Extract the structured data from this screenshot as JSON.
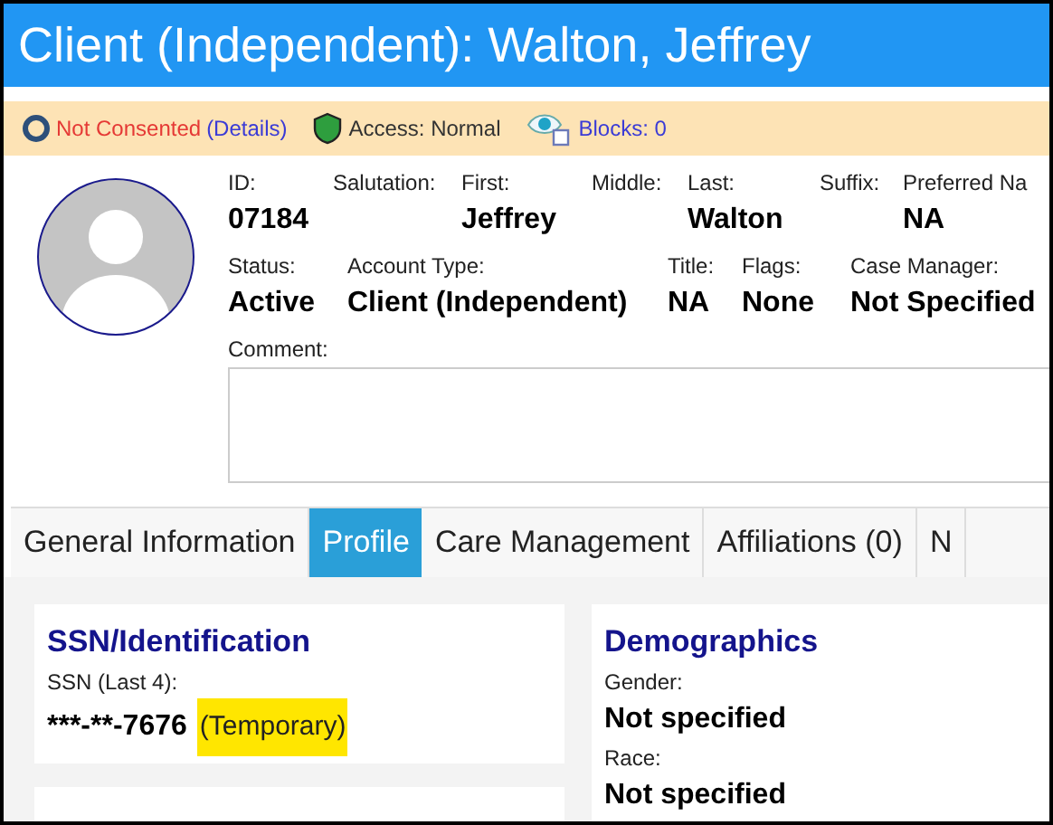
{
  "window": {
    "title": "Client (Independent): Walton, Jeffrey"
  },
  "banner": {
    "consent": "Not Consented",
    "details_link": "(Details)",
    "access": "Access: Normal",
    "blocks_link": "Blocks: 0"
  },
  "field_rows": [
    [
      {
        "label": "ID:",
        "value": "07184"
      },
      {
        "label": "Salutation:"
      },
      {
        "label": "First:",
        "value": "Jeffrey"
      },
      {
        "label": "Middle:"
      },
      {
        "label": "Last:",
        "value": "Walton"
      },
      {
        "label": "Suffix:"
      },
      {
        "label": "Preferred Na",
        "value": "NA"
      }
    ],
    [
      {
        "label": "Status:",
        "value": "Active"
      },
      {
        "label": "Account Type:",
        "value": "Client (Independent)"
      },
      {
        "label": "Title:",
        "value": "NA"
      },
      {
        "label": "Flags:",
        "value": "None"
      },
      {
        "label": "Case Manager:",
        "value": "Not Specified"
      }
    ]
  ],
  "comment": {
    "label": "Comment:"
  },
  "tabs": [
    {
      "label": "General Information",
      "selected": false
    },
    {
      "label": "Profile",
      "selected": true
    },
    {
      "label": "Care Management",
      "selected": false
    },
    {
      "label": "Affiliations (0)",
      "selected": false
    },
    {
      "label": "N",
      "selected": false
    }
  ],
  "cards_left": [
    {
      "title": "SSN/Identification",
      "label": "SSN (Last 4):",
      "value": "***-**-7676",
      "tag": "(Temporary)"
    }
  ],
  "cards_right": [
    {
      "title": "Demographics",
      "fields": [
        {
          "label": "Gender:",
          "value": "Not specified"
        },
        {
          "label": "Race:",
          "value": "Not specified"
        }
      ]
    }
  ]
}
